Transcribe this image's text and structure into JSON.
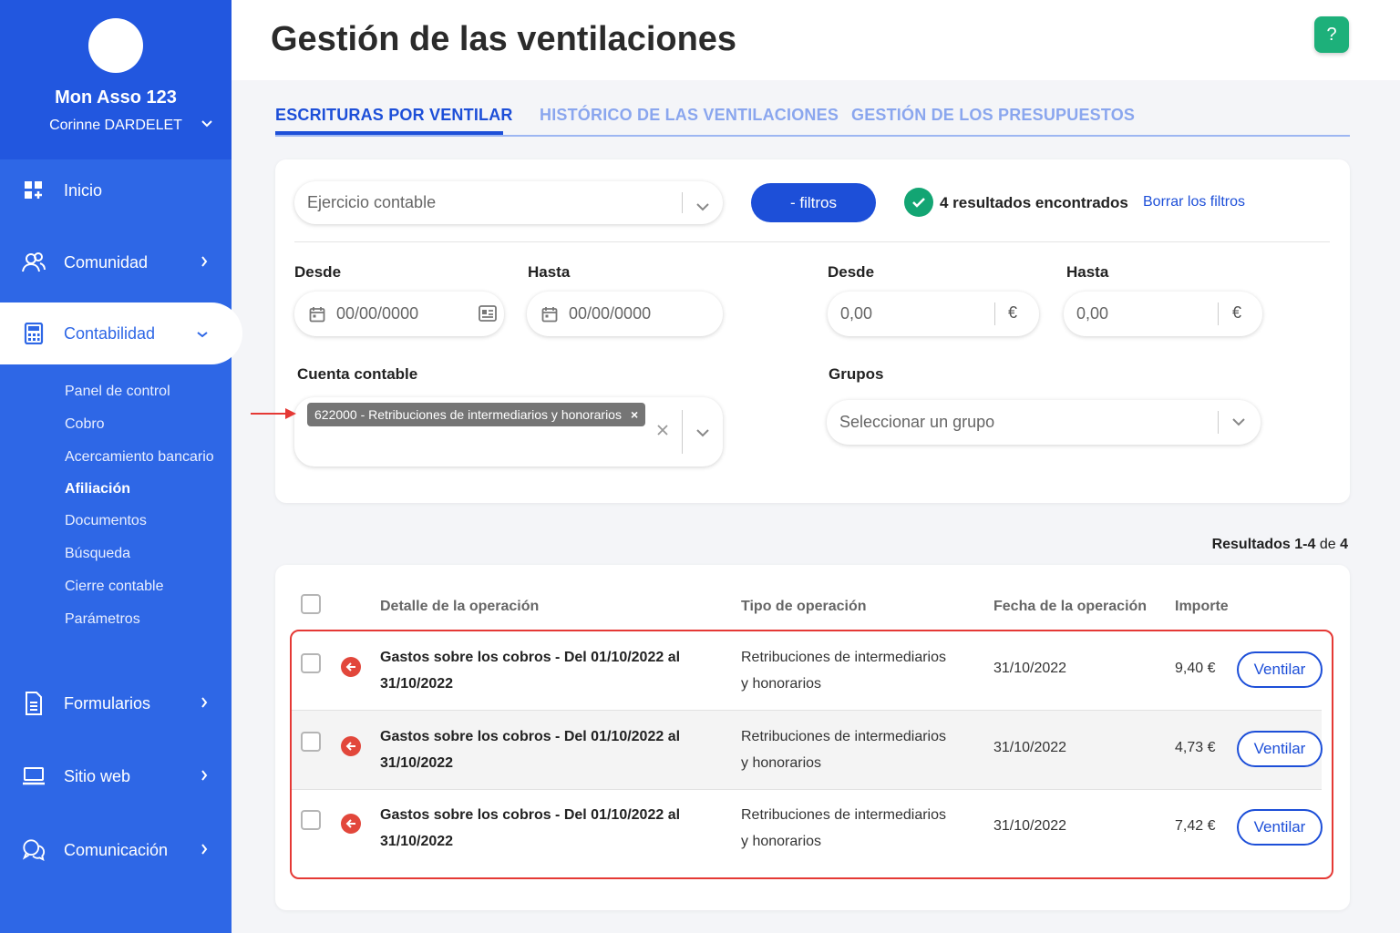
{
  "sidebar": {
    "org_name": "Mon Asso 123",
    "user_name": "Corinne DARDELET",
    "items": [
      {
        "label": "Inicio",
        "icon": "dashboard-icon"
      },
      {
        "label": "Comunidad",
        "icon": "users-icon"
      },
      {
        "label": "Contabilidad",
        "icon": "calculator-icon"
      },
      {
        "label": "Formularios",
        "icon": "document-icon"
      },
      {
        "label": "Sitio web",
        "icon": "laptop-icon"
      },
      {
        "label": "Comunicación",
        "icon": "chat-icon"
      }
    ],
    "subitems": [
      "Panel de control",
      "Cobro",
      "Acercamiento bancario",
      "Afiliación",
      "Documentos",
      "Búsqueda",
      "Cierre contable",
      "Parámetros"
    ]
  },
  "header": {
    "title": "Gestión de las ventilaciones",
    "help": "?"
  },
  "tabs": [
    "ESCRITURAS POR VENTILAR",
    "HISTÓRICO DE LAS VENTILACIONES",
    "GESTIÓN DE LOS PRESUPUESTOS"
  ],
  "filters": {
    "fiscal_year_placeholder": "Ejercicio contable",
    "toggle_label": "- filtros",
    "results_found": "4 resultados encontrados",
    "clear_label": "Borrar los filtros",
    "date_from_label": "Desde",
    "date_to_label": "Hasta",
    "date_placeholder": "00/00/0000",
    "amount_from_label": "Desde",
    "amount_to_label": "Hasta",
    "amount_placeholder": "0,00",
    "currency": "€",
    "account_label": "Cuenta contable",
    "account_chip": "622000 - Retribuciones de intermediarios y honorarios",
    "groups_label": "Grupos",
    "groups_placeholder": "Seleccionar un grupo"
  },
  "results": {
    "prefix": "Resultados",
    "range": "1-4",
    "of": "de",
    "total": "4"
  },
  "table": {
    "headers": [
      "Detalle de la operación",
      "Tipo de operación",
      "Fecha de la operación",
      "Importe"
    ],
    "action_label": "Ventilar",
    "rows": [
      {
        "detail_line1": "Gastos sobre los cobros - Del 01/10/2022 al",
        "detail_line2": "31/10/2022",
        "type_line1": "Retribuciones de intermediarios",
        "type_line2": "y honorarios",
        "date": "31/10/2022",
        "amount": "9,40 €"
      },
      {
        "detail_line1": "Gastos sobre los cobros - Del 01/10/2022 al",
        "detail_line2": "31/10/2022",
        "type_line1": "Retribuciones de intermediarios",
        "type_line2": "y honorarios",
        "date": "31/10/2022",
        "amount": "4,73 €"
      },
      {
        "detail_line1": "Gastos sobre los cobros - Del 01/10/2022 al",
        "detail_line2": "31/10/2022",
        "type_line1": "Retribuciones de intermediarios",
        "type_line2": "y honorarios",
        "date": "31/10/2022",
        "amount": "7,42 €"
      }
    ]
  },
  "colors": {
    "primary": "#1d4fd8",
    "sidebar": "#2e67e6",
    "success": "#13a573",
    "highlight": "#e53935"
  }
}
